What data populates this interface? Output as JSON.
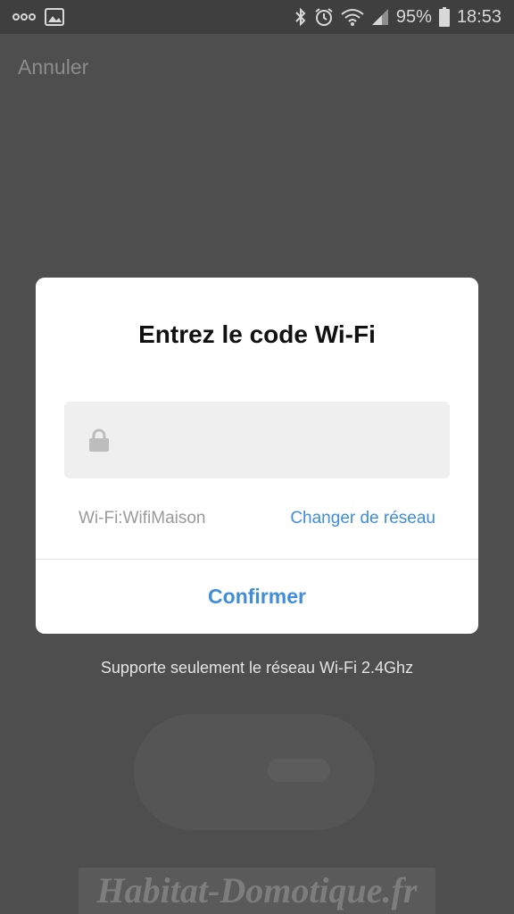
{
  "status_bar": {
    "battery": "95%",
    "time": "18:53",
    "icons": [
      "link-icon",
      "image-icon",
      "bluetooth-icon",
      "alarm-icon",
      "wifi-icon",
      "signal-icon",
      "battery-icon"
    ]
  },
  "screen": {
    "cancel_label": "Annuler",
    "support_note": "Supporte seulement le réseau Wi-Fi 2.4Ghz",
    "watermark": "Habitat-Domotique.fr"
  },
  "dialog": {
    "title": "Entrez le code Wi-Fi",
    "password_value": "",
    "wifi_label": "Wi-Fi:WifiMaison",
    "change_network_label": "Changer de réseau",
    "confirm_label": "Confirmer"
  },
  "colors": {
    "accent": "#3f8ddb",
    "overlay": "#4e4e4e",
    "dialog_bg": "#ffffff",
    "field_bg": "#efefef"
  }
}
